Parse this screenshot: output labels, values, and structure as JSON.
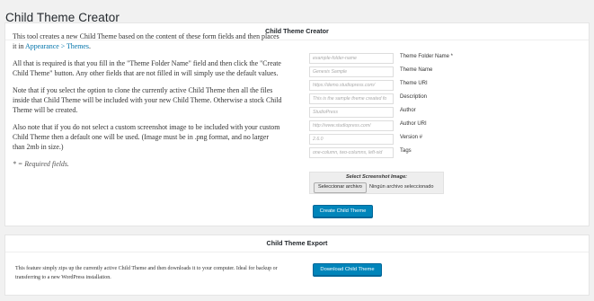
{
  "page": {
    "title": "Child Theme Creator"
  },
  "creator": {
    "heading": "Child Theme Creator",
    "intro_before_link": "This tool creates a new Child Theme based on the content of these form fields and then places it in ",
    "intro_link": "Appearance > Themes",
    "intro_after_link": ".",
    "para2": "All that is required is that you fill in the \"Theme Folder Name\" field and then click the \"Create Child Theme\" button. Any other fields that are not filled in will simply use the default values.",
    "para3": "Note that if you select the option to clone the currently active Child Theme then all the files inside that Child Theme will be included with your new Child Theme. Otherwise a stock Child Theme will be created.",
    "para4": "Also note that if you do not select a custom screenshot image to be included with your custom Child Theme then a default one will be used. (Image must be in .png format, and no larger than 2mb in size.)",
    "required_note": "* = Required fields.",
    "fields": [
      {
        "placeholder": "example-folder-name",
        "label": "Theme Folder Name *"
      },
      {
        "placeholder": "Genesis Sample",
        "label": "Theme Name"
      },
      {
        "placeholder": "https://demo.studiopress.com/",
        "label": "Theme URI"
      },
      {
        "placeholder": "This is the sample theme created fo",
        "label": "Description"
      },
      {
        "placeholder": "StudioPress",
        "label": "Author"
      },
      {
        "placeholder": "http://www.studiopress.com/",
        "label": "Author URI"
      },
      {
        "placeholder": "2.6.0",
        "label": "Version #"
      },
      {
        "placeholder": "one-column, two-columns, left-sid",
        "label": "Tags"
      }
    ],
    "screenshot": {
      "title": "Select Screenshot Image:",
      "button": "Seleccionar archivo",
      "status": "Ningún archivo seleccionado"
    },
    "submit_label": "Create Child Theme"
  },
  "export": {
    "heading": "Child Theme Export",
    "description": "This feature simply zips up the currently active Child Theme and then downloads it to your computer. Ideal for backup or transferring to a new WordPress installation.",
    "button_label": "Download Child Theme"
  },
  "colors": {
    "primary_button": "#0085ba",
    "link": "#0073aa",
    "background": "#f1f1f1"
  }
}
